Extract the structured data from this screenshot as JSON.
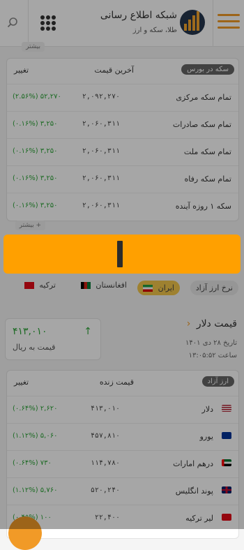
{
  "header": {
    "brand_title": "شبکه اطلاع رسانی",
    "brand_subtitle": "طلا، سکه و ارز"
  },
  "coin_section": {
    "more_tag_top": "بیشتر",
    "tab_label": "سکه در بورس",
    "col_price": "آخرین قیمت",
    "col_change": "تغییر",
    "rows": [
      {
        "name": "تمام سکه مرکزی",
        "price": "۲,۰۹۲,۲۷۰",
        "change": "۵۲,۲۷۰ (۲.۵۶%)"
      },
      {
        "name": "تمام سکه صادرات",
        "price": "۲,۰۶۰,۳۱۱",
        "change": "۳,۲۵۰ (۰.۱۶%)"
      },
      {
        "name": "تمام سکه ملت",
        "price": "۲,۰۶۰,۳۱۱",
        "change": "۳,۲۵۰ (۰.۱۶%)"
      },
      {
        "name": "تمام سکه رفاه",
        "price": "۲,۰۶۰,۳۱۱",
        "change": "۳,۲۵۰ (۰.۱۶%)"
      },
      {
        "name": "سکه ۱ روزه آینده",
        "price": "۲,۰۶۰,۳۱۱",
        "change": "۳,۲۵۰ (۰.۱۶%)"
      }
    ],
    "more_tag": "بیشتر"
  },
  "tabs": {
    "free_rate": "نرخ ارز آزاد",
    "iran": "ایران",
    "afghanistan": "افغانستان",
    "turkey": "ترکیه"
  },
  "dollar": {
    "title": "قیمت دلار",
    "date": "تاریخ ۲۸ دی ۱۴۰۱",
    "time": "ساعت ۱۳:۰۵:۵۲",
    "value": "۴۱۳,۰۱۰",
    "unit": "قیمت به ریال"
  },
  "currency_section": {
    "tab_label": "ارز آزاد",
    "col_price": "قیمت زنده",
    "col_change": "تغییر",
    "rows": [
      {
        "name": "دلار",
        "price": "۴۱۳,۰۱۰",
        "change": "۲,۶۲۰ (۰.۶۴%)",
        "flag": "us"
      },
      {
        "name": "یورو",
        "price": "۴۵۷,۸۱۰",
        "change": "۵,۰۶۰ (۱.۱۲%)",
        "flag": "eu"
      },
      {
        "name": "درهم امارات",
        "price": "۱۱۴,۷۸۰",
        "change": "۷۳۰ (۰.۶۴%)",
        "flag": "ae"
      },
      {
        "name": "پوند انگلیس",
        "price": "۵۲۰,۲۴۰",
        "change": "۵,۷۶۰ (۱.۱۲%)",
        "flag": "gb"
      },
      {
        "name": "لیر ترکیه",
        "price": "۲۲,۴۰۰",
        "change": "۱۰۰ (۰.۴۵%)",
        "flag": "tr"
      }
    ]
  },
  "colors": {
    "accent": "#f19a27",
    "ad": "#ffa000",
    "positive": "#2ea53a"
  }
}
